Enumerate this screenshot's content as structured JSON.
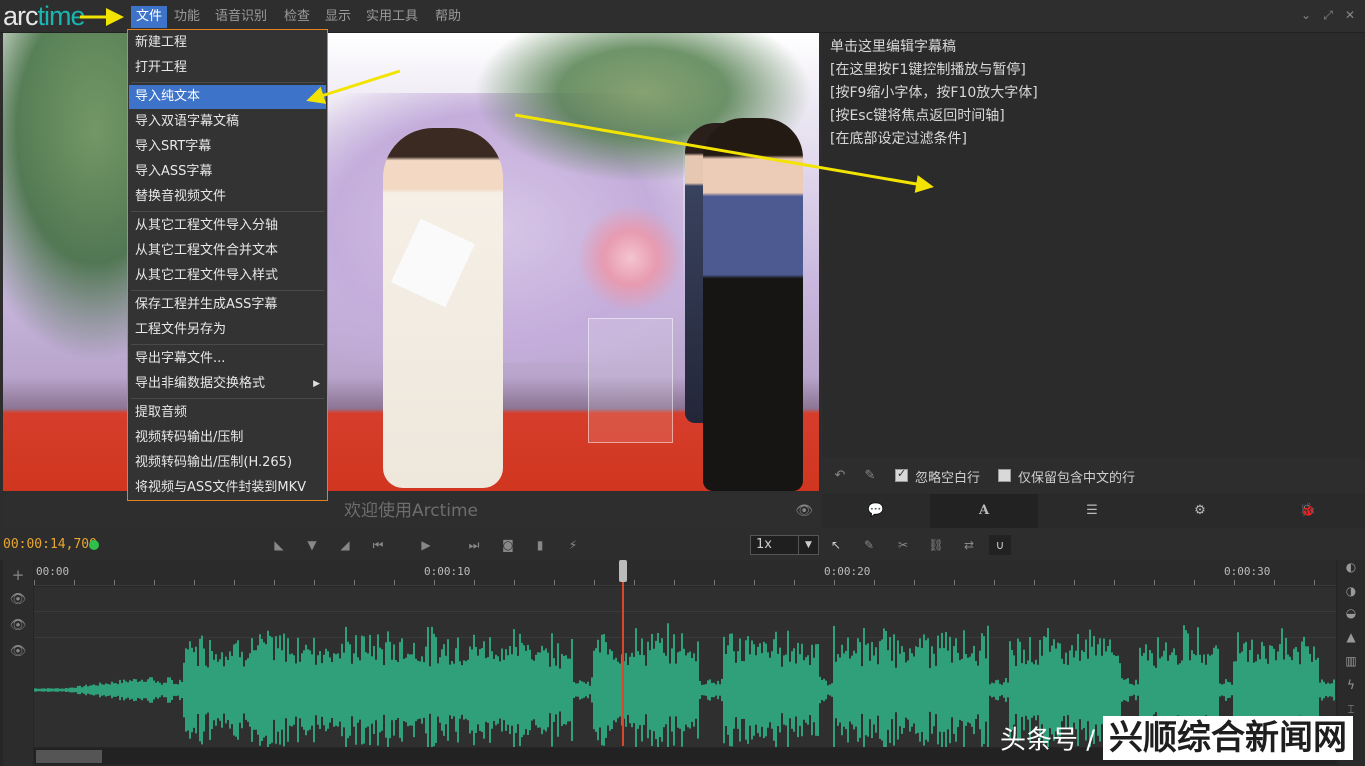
{
  "app": {
    "logo_part1": "arc",
    "logo_part2": "time"
  },
  "menubar": {
    "items": [
      "文件",
      "功能",
      "语音识别",
      "检查",
      "显示",
      "实用工具",
      "帮助"
    ],
    "window_buttons": [
      "⌄",
      "⤢",
      "✕"
    ]
  },
  "file_menu": {
    "items": [
      "新建工程",
      "打开工程",
      "导入纯文本",
      "导入双语字幕文稿",
      "导入SRT字幕",
      "导入ASS字幕",
      "替换音视频文件",
      "从其它工程文件导入分轴",
      "从其它工程文件合并文本",
      "从其它工程文件导入样式",
      "保存工程并生成ASS字幕",
      "工程文件另存为",
      "导出字幕文件...",
      "导出非编数据交换格式",
      "提取音频",
      "视频转码输出/压制",
      "视频转码输出/压制(H.265)",
      "将视频与ASS文件封装到MKV"
    ],
    "highlighted": "导入纯文本",
    "submenu_arrow": "▶"
  },
  "video": {
    "welcome_text": "欢迎使用Arctime",
    "eye_icon": "👁"
  },
  "script_panel": {
    "lines": [
      "单击这里编辑字幕稿",
      "[在这里按F1键控制播放与暂停]",
      "[按F9缩小字体，按F10放大字体]",
      "[按Esc键将焦点返回时间轴]",
      "[在底部设定过滤条件]"
    ],
    "option_ignore_blank": "忽略空白行",
    "option_chinese_only": "仅保留包含中文的行"
  },
  "tabs": [
    "💬",
    "A",
    "☰",
    "⚙",
    "🐞"
  ],
  "transport": {
    "timecode": "00:00:14,700",
    "speed": "1x",
    "speed_arrow": "▼"
  },
  "timeline": {
    "ruler_labels": [
      "00:00",
      "0:00:10",
      "0:00:20",
      "0:00:30"
    ],
    "add_icon": "+",
    "eye_icon": "👁",
    "playhead_time_s": 14.7
  },
  "watermark": {
    "source": "头条号 /",
    "brand": "兴顺综合新闻网"
  },
  "colors": {
    "accent": "#3d74c9",
    "menu_border": "#e2821f",
    "timecode": "#e8a632",
    "wave": "#2fa07a",
    "playhead": "#d8462b",
    "arrow": "#f2e400"
  }
}
